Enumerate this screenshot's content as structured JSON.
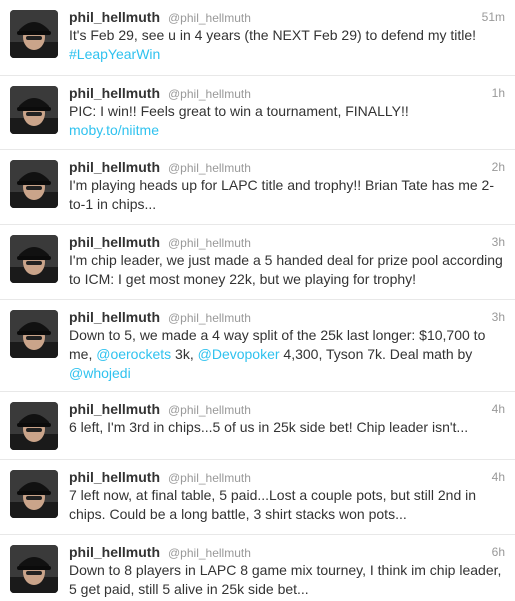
{
  "colors": {
    "link": "#2fc2ef",
    "meta": "#999999",
    "text": "#333333",
    "divider": "#e8e8e8"
  },
  "tweets": [
    {
      "name": "phil_hellmuth",
      "handle": "@phil_hellmuth",
      "time": "51m",
      "text": "It's Feb 29, see u in 4 years (the NEXT Feb 29) to defend my title! ",
      "link1": "#LeapYearWin"
    },
    {
      "name": "phil_hellmuth",
      "handle": "@phil_hellmuth",
      "time": "1h",
      "text": "PIC: I win!! Feels great to win a tournament, FINALLY!! ",
      "link1": "moby.to/niitme"
    },
    {
      "name": "phil_hellmuth",
      "handle": "@phil_hellmuth",
      "time": "2h",
      "text": "I'm playing heads up for LAPC title and trophy!! Brian Tate has me 2-to-1 in chips..."
    },
    {
      "name": "phil_hellmuth",
      "handle": "@phil_hellmuth",
      "time": "3h",
      "text": "I'm chip leader, we just made a 5 handed deal for prize pool according to ICM: I get most money 22k, but we playing for trophy!"
    },
    {
      "name": "phil_hellmuth",
      "handle": "@phil_hellmuth",
      "time": "3h",
      "text": "Down to 5, we made a 4 way split of the 25k last longer: $10,700 to me, ",
      "mention1": "@oerockets",
      "text2": " 3k, ",
      "mention2": "@Devopoker",
      "text3": " 4,300, Tyson 7k. Deal math by ",
      "mention3": "@whojedi"
    },
    {
      "name": "phil_hellmuth",
      "handle": "@phil_hellmuth",
      "time": "4h",
      "text": "6 left, I'm 3rd in chips...5 of us in 25k side bet! Chip leader isn't..."
    },
    {
      "name": "phil_hellmuth",
      "handle": "@phil_hellmuth",
      "time": "4h",
      "text": "7 left now, at final table, 5 paid...Lost a couple pots, but still 2nd in chips. Could be a long battle, 3 shirt stacks won pots..."
    },
    {
      "name": "phil_hellmuth",
      "handle": "@phil_hellmuth",
      "time": "6h",
      "text": "Down to 8 players in LAPC 8 game mix tourney, I think im chip leader, 5 get paid, still 5 alive in 25k side bet..."
    }
  ]
}
